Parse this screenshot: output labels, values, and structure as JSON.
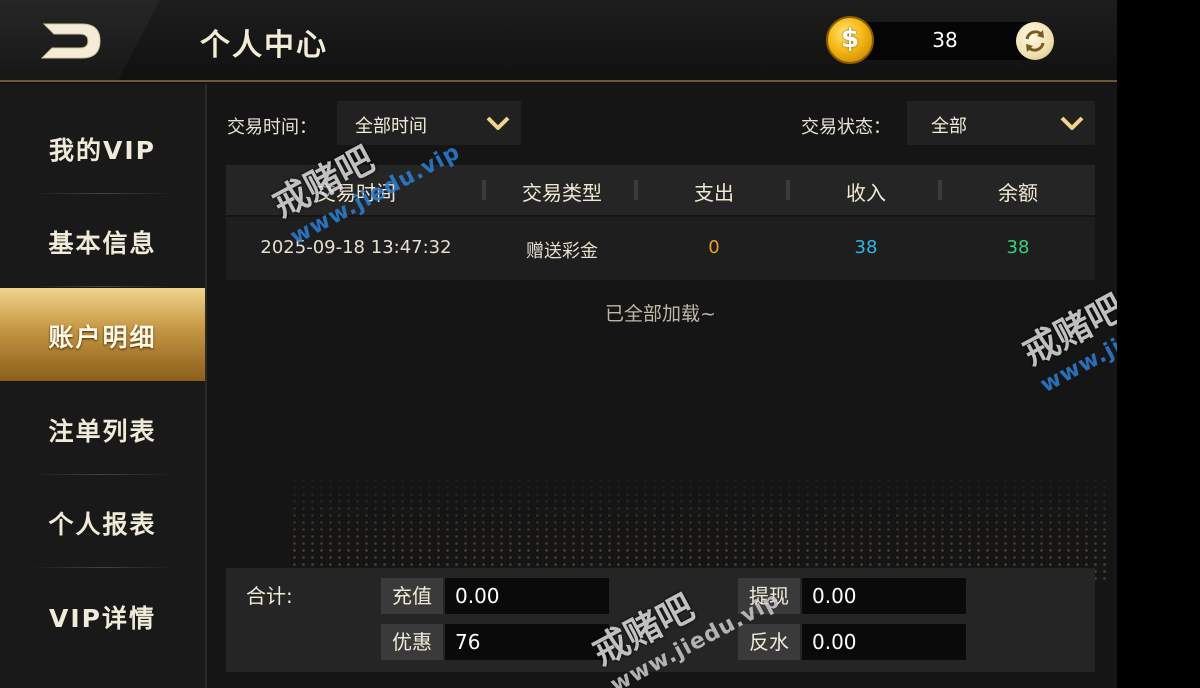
{
  "header": {
    "title": "个人中心",
    "coin_symbol": "$",
    "balance": "38",
    "back_icon": "back-arrow-icon",
    "refresh_icon": "refresh-icon"
  },
  "sidebar": {
    "items": [
      {
        "label": "我的VIP",
        "active": false
      },
      {
        "label": "基本信息",
        "active": false
      },
      {
        "label": "账户明细",
        "active": true
      },
      {
        "label": "注单列表",
        "active": false
      },
      {
        "label": "个人报表",
        "active": false
      },
      {
        "label": "VIP详情",
        "active": false
      }
    ]
  },
  "filters": {
    "time_label": "交易时间：",
    "time_value": "全部时间",
    "status_label": "交易状态：",
    "status_value": "全部"
  },
  "table": {
    "headers": [
      "交易时间",
      "交易类型",
      "支出",
      "收入",
      "余额"
    ],
    "rows": [
      {
        "time": "2025-09-18 13:47:32",
        "type": "赠送彩金",
        "out": "0",
        "in": "38",
        "balance": "38"
      }
    ],
    "loaded_text": "已全部加载~"
  },
  "totals": {
    "label": "合计:",
    "recharge_label": "充值",
    "recharge_value": "0.00",
    "withdraw_label": "提现",
    "withdraw_value": "0.00",
    "bonus_label": "优惠",
    "bonus_value": "76",
    "rebate_label": "反水",
    "rebate_value": "0.00"
  },
  "colors": {
    "accent_gold": "#c49642",
    "out_color": "#e6a12a",
    "in_color": "#2fb6e8",
    "balance_color": "#35d07f"
  },
  "watermark": {
    "cn": "戒赌吧",
    "url": "www.jiedu.vip"
  }
}
